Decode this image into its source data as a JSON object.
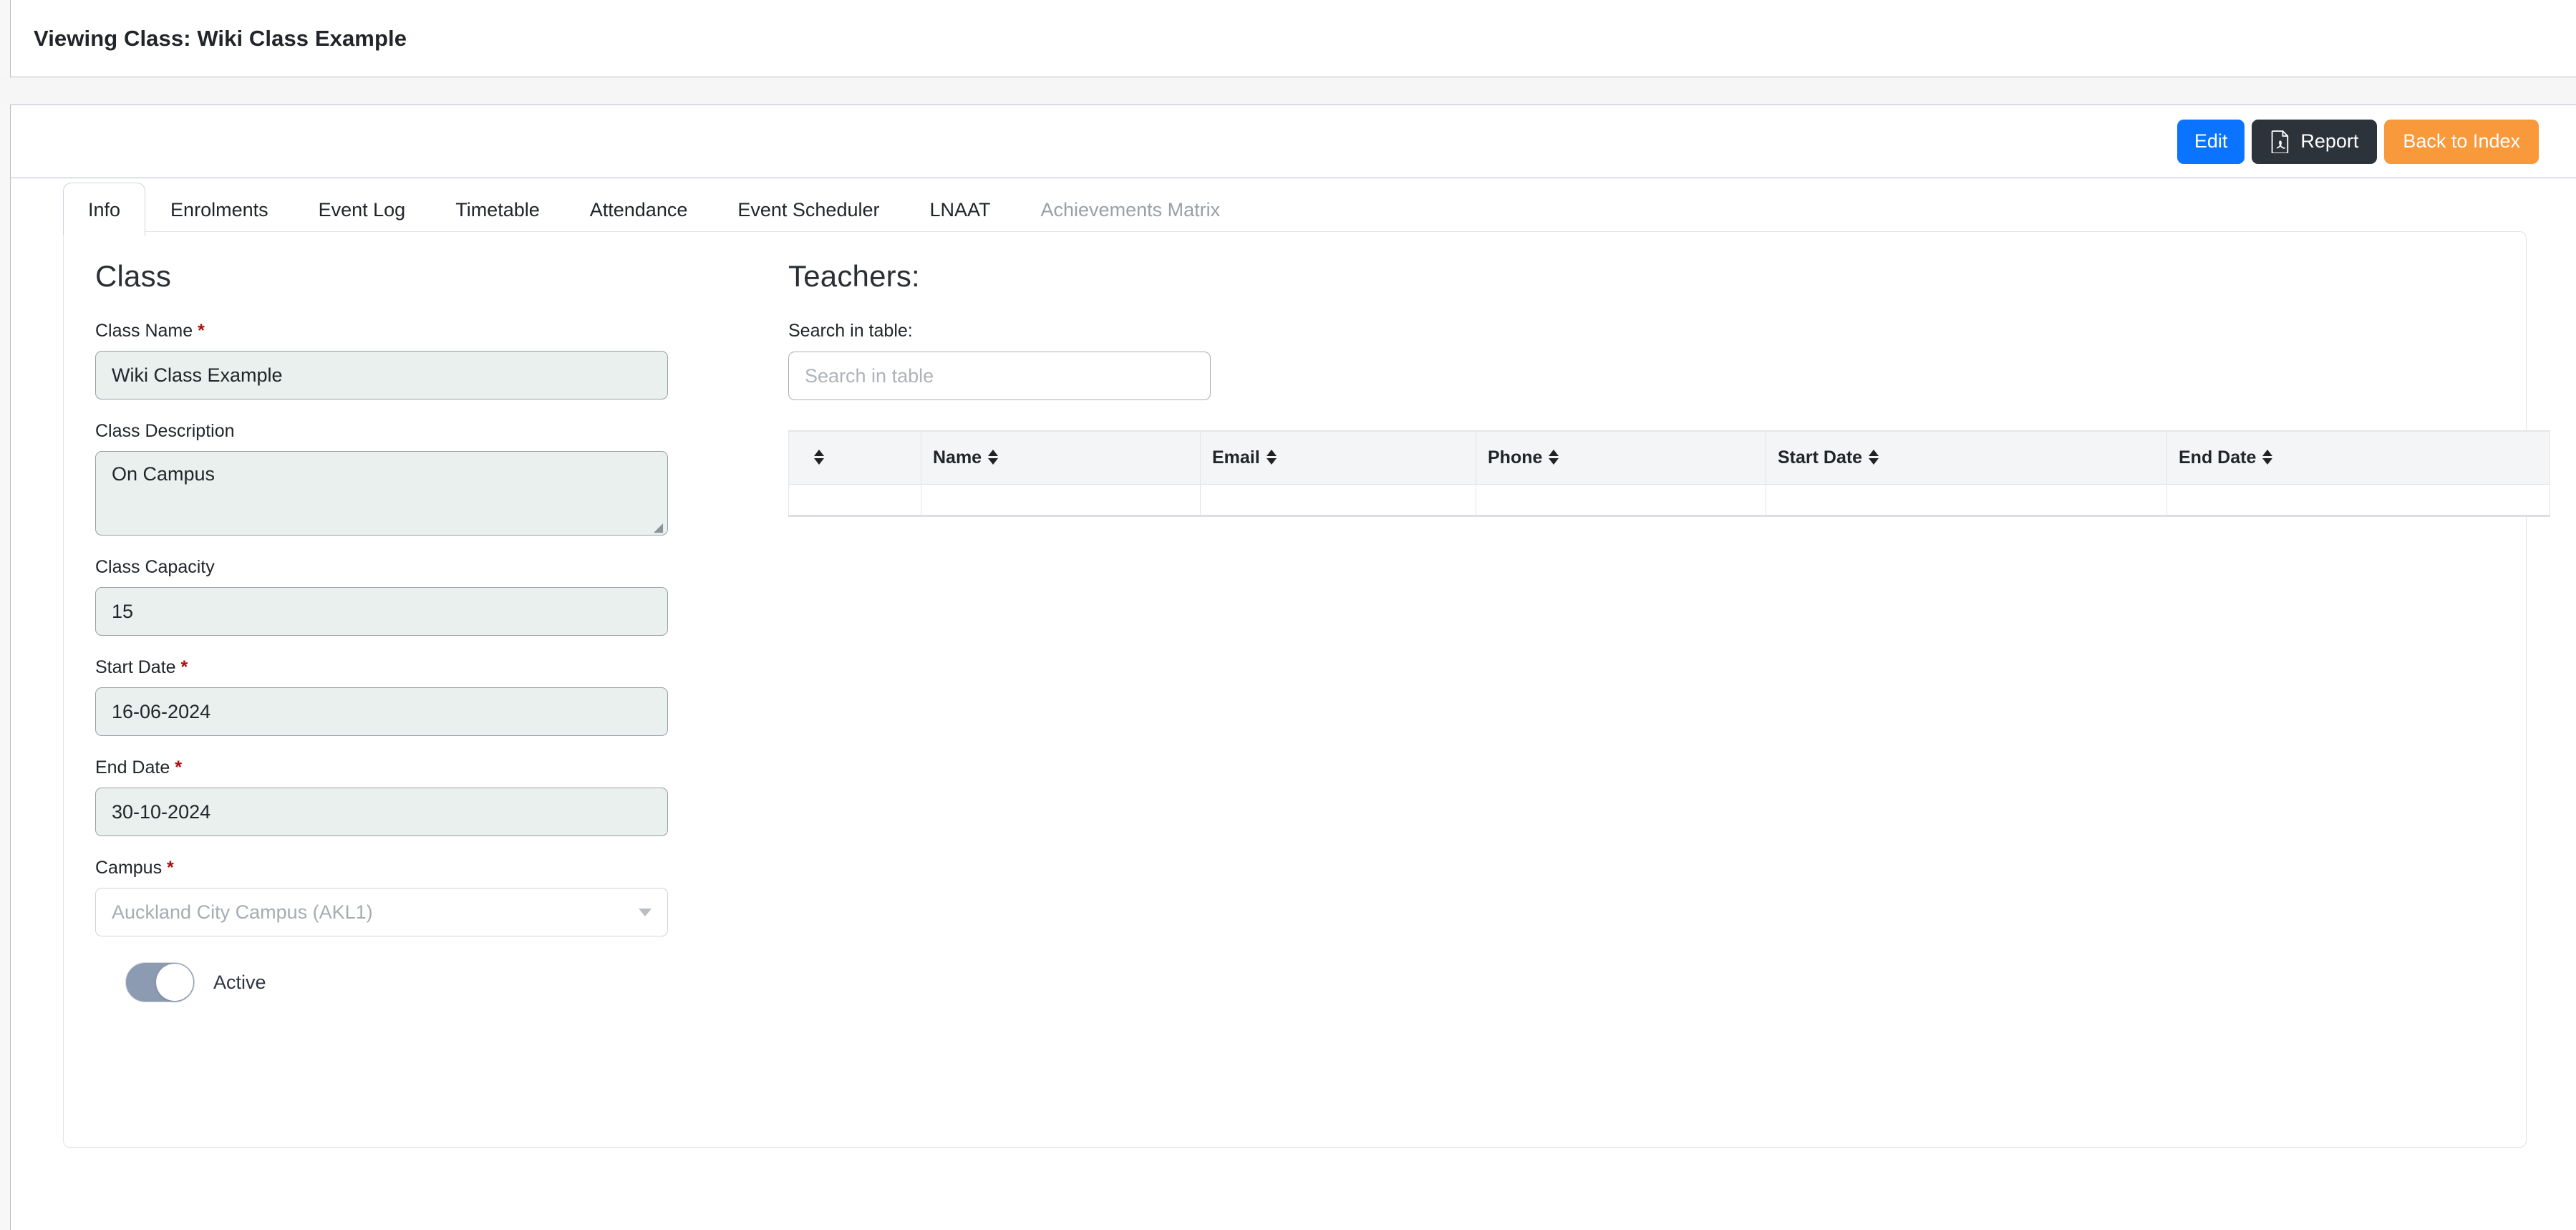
{
  "header": {
    "title": "Viewing Class: Wiki Class Example"
  },
  "toolbar": {
    "edit_label": "Edit",
    "report_label": "Report",
    "report_icon": "file-pdf-icon",
    "back_label": "Back to Index",
    "colors": {
      "edit": "#0a73ff",
      "report": "#2c333b",
      "back": "#f8993c"
    }
  },
  "tabs": [
    {
      "label": "Info",
      "state": "active"
    },
    {
      "label": "Enrolments",
      "state": "normal"
    },
    {
      "label": "Event Log",
      "state": "normal"
    },
    {
      "label": "Timetable",
      "state": "normal"
    },
    {
      "label": "Attendance",
      "state": "normal"
    },
    {
      "label": "Event Scheduler",
      "state": "normal"
    },
    {
      "label": "LNAAT",
      "state": "normal"
    },
    {
      "label": "Achievements Matrix",
      "state": "disabled"
    }
  ],
  "form": {
    "section_title": "Class",
    "required_marker": "*",
    "fields": {
      "class_name": {
        "label": "Class Name",
        "required": true,
        "value": "Wiki Class Example"
      },
      "class_description": {
        "label": "Class Description",
        "required": false,
        "value": "On Campus"
      },
      "class_capacity": {
        "label": "Class Capacity",
        "required": false,
        "value": "15"
      },
      "start_date": {
        "label": "Start Date",
        "required": true,
        "value": "16-06-2024"
      },
      "end_date": {
        "label": "End Date",
        "required": true,
        "value": "30-10-2024"
      },
      "campus": {
        "label": "Campus",
        "required": true,
        "value": "Auckland City Campus (AKL1)",
        "disabled": true
      }
    },
    "active_toggle": {
      "label": "Active",
      "on": true,
      "track_color": "#8c9bb2"
    }
  },
  "teachers": {
    "section_title": "Teachers:",
    "search": {
      "label": "Search in table:",
      "placeholder": "Search in table",
      "value": ""
    },
    "columns": [
      {
        "label": "",
        "sortable": true
      },
      {
        "label": "Name",
        "sortable": true
      },
      {
        "label": "Email",
        "sortable": true
      },
      {
        "label": "Phone",
        "sortable": true
      },
      {
        "label": "Start Date",
        "sortable": true
      },
      {
        "label": "End Date",
        "sortable": true
      }
    ],
    "rows": []
  }
}
